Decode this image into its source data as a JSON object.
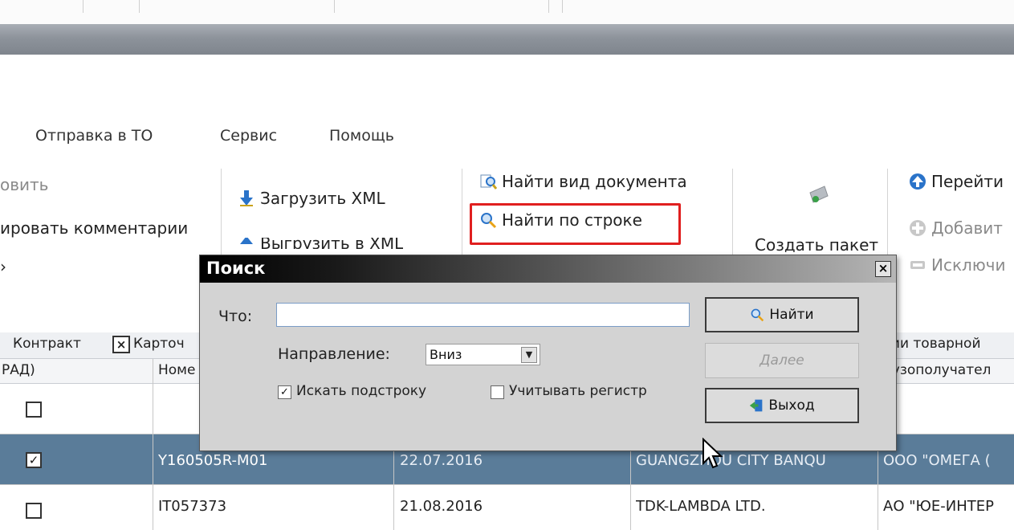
{
  "menu": {
    "items": [
      "Отправка в ТО",
      "Сервис",
      "Помощь"
    ]
  },
  "ribbon": {
    "col1": [
      "овить",
      "ировать комментарии",
      "›"
    ],
    "load_xml": "Загрузить XML",
    "export_xml_partial": "Выгрузить в XML",
    "find_doc_type": "Найти вид документа",
    "find_by_string": "Найти по строке",
    "create_package": "Создать пакет",
    "goto": "Перейти",
    "add": "Добавит",
    "exclude": "Исключи"
  },
  "grid": {
    "tabs": [
      "Контракт",
      "Карточ",
      "тии товарной"
    ],
    "headers": [
      "РАД)",
      "Номе",
      "рузополучател"
    ],
    "rows": [
      {
        "checked": false,
        "number": "",
        "date": "",
        "sender": "",
        "receiver": ""
      },
      {
        "checked": true,
        "number": "Y160505R-M01",
        "date": "22.07.2016",
        "sender": "GUANGZHOU CITY BANQU",
        "receiver": "ООО \"ОМЕГА ("
      },
      {
        "checked": false,
        "number": "IT057373",
        "date": "21.08.2016",
        "sender": "TDK-LAMBDA LTD.",
        "receiver": "АО \"ЮЕ-ИНТЕР"
      }
    ],
    "selected_row_color": "#5a7c99"
  },
  "dialog": {
    "title": "Поиск",
    "close_glyph": "×",
    "what_label": "Что:",
    "what_value": "",
    "direction_label": "Направление:",
    "direction_value": "Вниз",
    "substring_label": "Искать подстроку",
    "substring_checked": true,
    "case_label": "Учитывать регистр",
    "case_checked": false,
    "find_button": "Найти",
    "next_button": "Далее",
    "exit_button": "Выход"
  },
  "colors": {
    "highlight": "#e01f1f",
    "accent_blue": "#2a73c9"
  }
}
